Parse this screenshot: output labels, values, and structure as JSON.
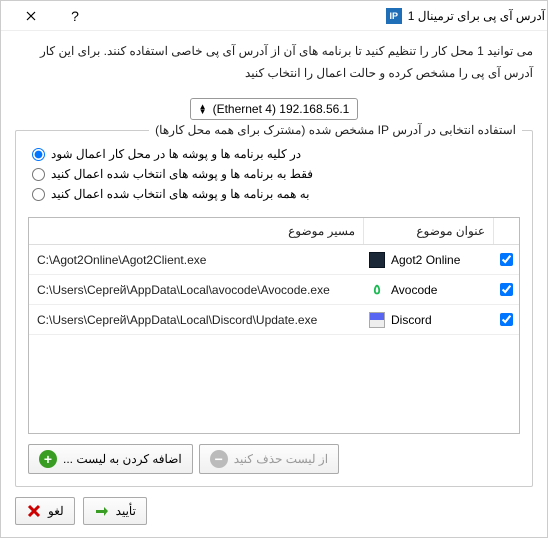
{
  "window": {
    "title": "آدرس آی پی برای ترمینال 1",
    "app_icon": "IP"
  },
  "description": "می توانید 1 محل کار را تنظیم کنید تا برنامه های آن از آدرس آی پی  خاصی استفاده کنند. برای این کار آدرس آی پی را مشخص کرده و حالت اعمال را انتخاب کنید",
  "dropdown": {
    "label": "(Ethernet 4) 192.168.56.1"
  },
  "group": {
    "title": "استفاده انتخابی در آدرس IP مشخص شده (مشترک برای همه محل کارها)"
  },
  "radios": [
    {
      "label": "در کلیه برنامه ها و پوشه ها در محل کار اعمال شود",
      "checked": true
    },
    {
      "label": "فقط به برنامه ها و پوشه های انتخاب شده اعمال کنید",
      "checked": false
    },
    {
      "label": "به همه برنامه ها و پوشه های انتخاب شده اعمال کنید",
      "checked": false
    }
  ],
  "table": {
    "headers": {
      "subject": "عنوان موضوع",
      "path": "مسیر موضوع"
    },
    "rows": [
      {
        "subject": "Agot2 Online",
        "path": "C:\\Agot2Online\\Agot2Client.exe",
        "icon": "agot",
        "checked": true
      },
      {
        "subject": "Avocode",
        "path": "C:\\Users\\Сергей\\AppData\\Local\\avocode\\Avocode.exe",
        "icon": "avo",
        "checked": true
      },
      {
        "subject": "Discord",
        "path": "C:\\Users\\Сергей\\AppData\\Local\\Discord\\Update.exe",
        "icon": "discord",
        "checked": true
      }
    ]
  },
  "list_buttons": {
    "remove": "از لیست حذف کنید",
    "add": "اضافه کردن به لیست ..."
  },
  "footer": {
    "ok": "تأیید",
    "cancel": "لغو"
  }
}
